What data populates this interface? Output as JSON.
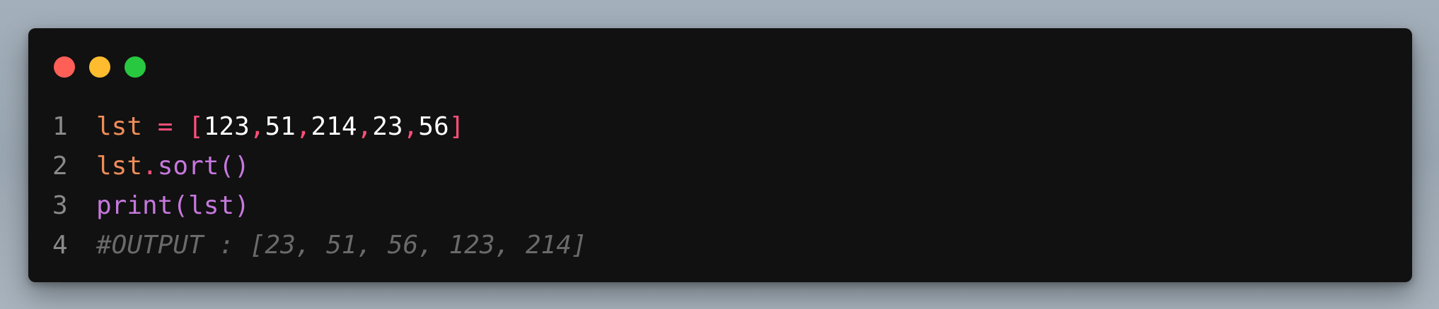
{
  "colors": {
    "window_bg": "#111111",
    "page_bg": "#a3afba",
    "close": "#ff5f57",
    "minimize": "#febc2e",
    "maximize": "#28c840",
    "line_number": "#8a8a8a",
    "variable": "#f08d5a",
    "operator": "#ff4f7a",
    "number": "#ffffff",
    "method": "#c678dd",
    "comment": "#6a6a6a"
  },
  "window_controls": {
    "close_icon": "close-dot-icon",
    "minimize_icon": "minimize-dot-icon",
    "maximize_icon": "maximize-dot-icon"
  },
  "code": {
    "language": "python",
    "lines": [
      {
        "number": "1",
        "tokens": [
          {
            "text": "lst",
            "kind": "variable"
          },
          {
            "text": " = ",
            "kind": "operator"
          },
          {
            "text": "[",
            "kind": "operator"
          },
          {
            "text": "123",
            "kind": "number"
          },
          {
            "text": ",",
            "kind": "operator"
          },
          {
            "text": "51",
            "kind": "number"
          },
          {
            "text": ",",
            "kind": "operator"
          },
          {
            "text": "214",
            "kind": "number"
          },
          {
            "text": ",",
            "kind": "operator"
          },
          {
            "text": "23",
            "kind": "number"
          },
          {
            "text": ",",
            "kind": "operator"
          },
          {
            "text": "56",
            "kind": "number"
          },
          {
            "text": "]",
            "kind": "operator"
          }
        ]
      },
      {
        "number": "2",
        "tokens": [
          {
            "text": "lst",
            "kind": "variable"
          },
          {
            "text": ".",
            "kind": "operator"
          },
          {
            "text": "sort",
            "kind": "method"
          },
          {
            "text": "()",
            "kind": "method"
          }
        ]
      },
      {
        "number": "3",
        "tokens": [
          {
            "text": "print",
            "kind": "method"
          },
          {
            "text": "(",
            "kind": "method"
          },
          {
            "text": "lst",
            "kind": "method"
          },
          {
            "text": ")",
            "kind": "method"
          }
        ]
      },
      {
        "number": "4",
        "tokens": [
          {
            "text": "#OUTPUT : [23, 51, 56, 123, 214]",
            "kind": "comment"
          }
        ]
      }
    ]
  }
}
